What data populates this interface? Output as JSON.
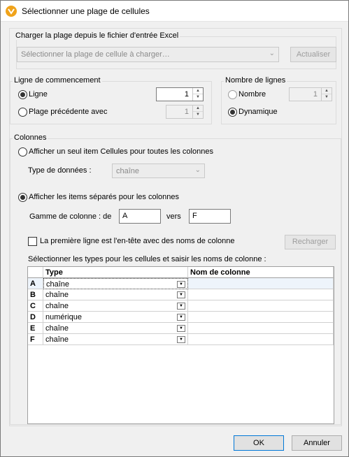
{
  "window": {
    "title": "Sélectionner une plage de cellules"
  },
  "load_group": {
    "label": "Charger la plage depuis le fichier d'entrée Excel",
    "dropdown_placeholder": "Sélectionner la plage de cellule à charger…",
    "refresh_label": "Actualiser"
  },
  "start_group": {
    "label": "Ligne de commencement",
    "option_line": "Ligne",
    "line_value": "1",
    "option_previous": "Plage précédente avec",
    "previous_value": "1"
  },
  "rows_group": {
    "label": "Nombre de lignes",
    "option_number": "Nombre",
    "number_value": "1",
    "option_dynamic": "Dynamique"
  },
  "columns_group": {
    "label": "Colonnes",
    "option_single": "Afficher un seul item Cellules pour toutes les colonnes",
    "data_type_label": "Type de données :",
    "data_type_value": "chaîne",
    "option_separate": "Afficher les items séparés pour les colonnes",
    "range_label": "Gamme de colonne : de",
    "range_from": "A",
    "range_to_label": "vers",
    "range_to": "F",
    "header_checkbox_label": "La première ligne est l'en-tête avec des noms de colonne",
    "reload_label": "Recharger",
    "grid_caption": "Sélectionner les types pour les cellules et saisir les noms de colonne :"
  },
  "grid": {
    "headers": [
      "",
      "Type",
      "Nom de colonne"
    ],
    "rows": [
      {
        "col": "A",
        "type": "chaîne",
        "name": ""
      },
      {
        "col": "B",
        "type": "chaîne",
        "name": ""
      },
      {
        "col": "C",
        "type": "chaîne",
        "name": ""
      },
      {
        "col": "D",
        "type": "numérique",
        "name": ""
      },
      {
        "col": "E",
        "type": "chaîne",
        "name": ""
      },
      {
        "col": "F",
        "type": "chaîne",
        "name": ""
      }
    ]
  },
  "footer": {
    "ok_label": "OK",
    "cancel_label": "Annuler"
  },
  "colors": {
    "app_icon": "#f0a31b",
    "focus_border": "#0078d7",
    "selected_row": "#eef4fb"
  }
}
